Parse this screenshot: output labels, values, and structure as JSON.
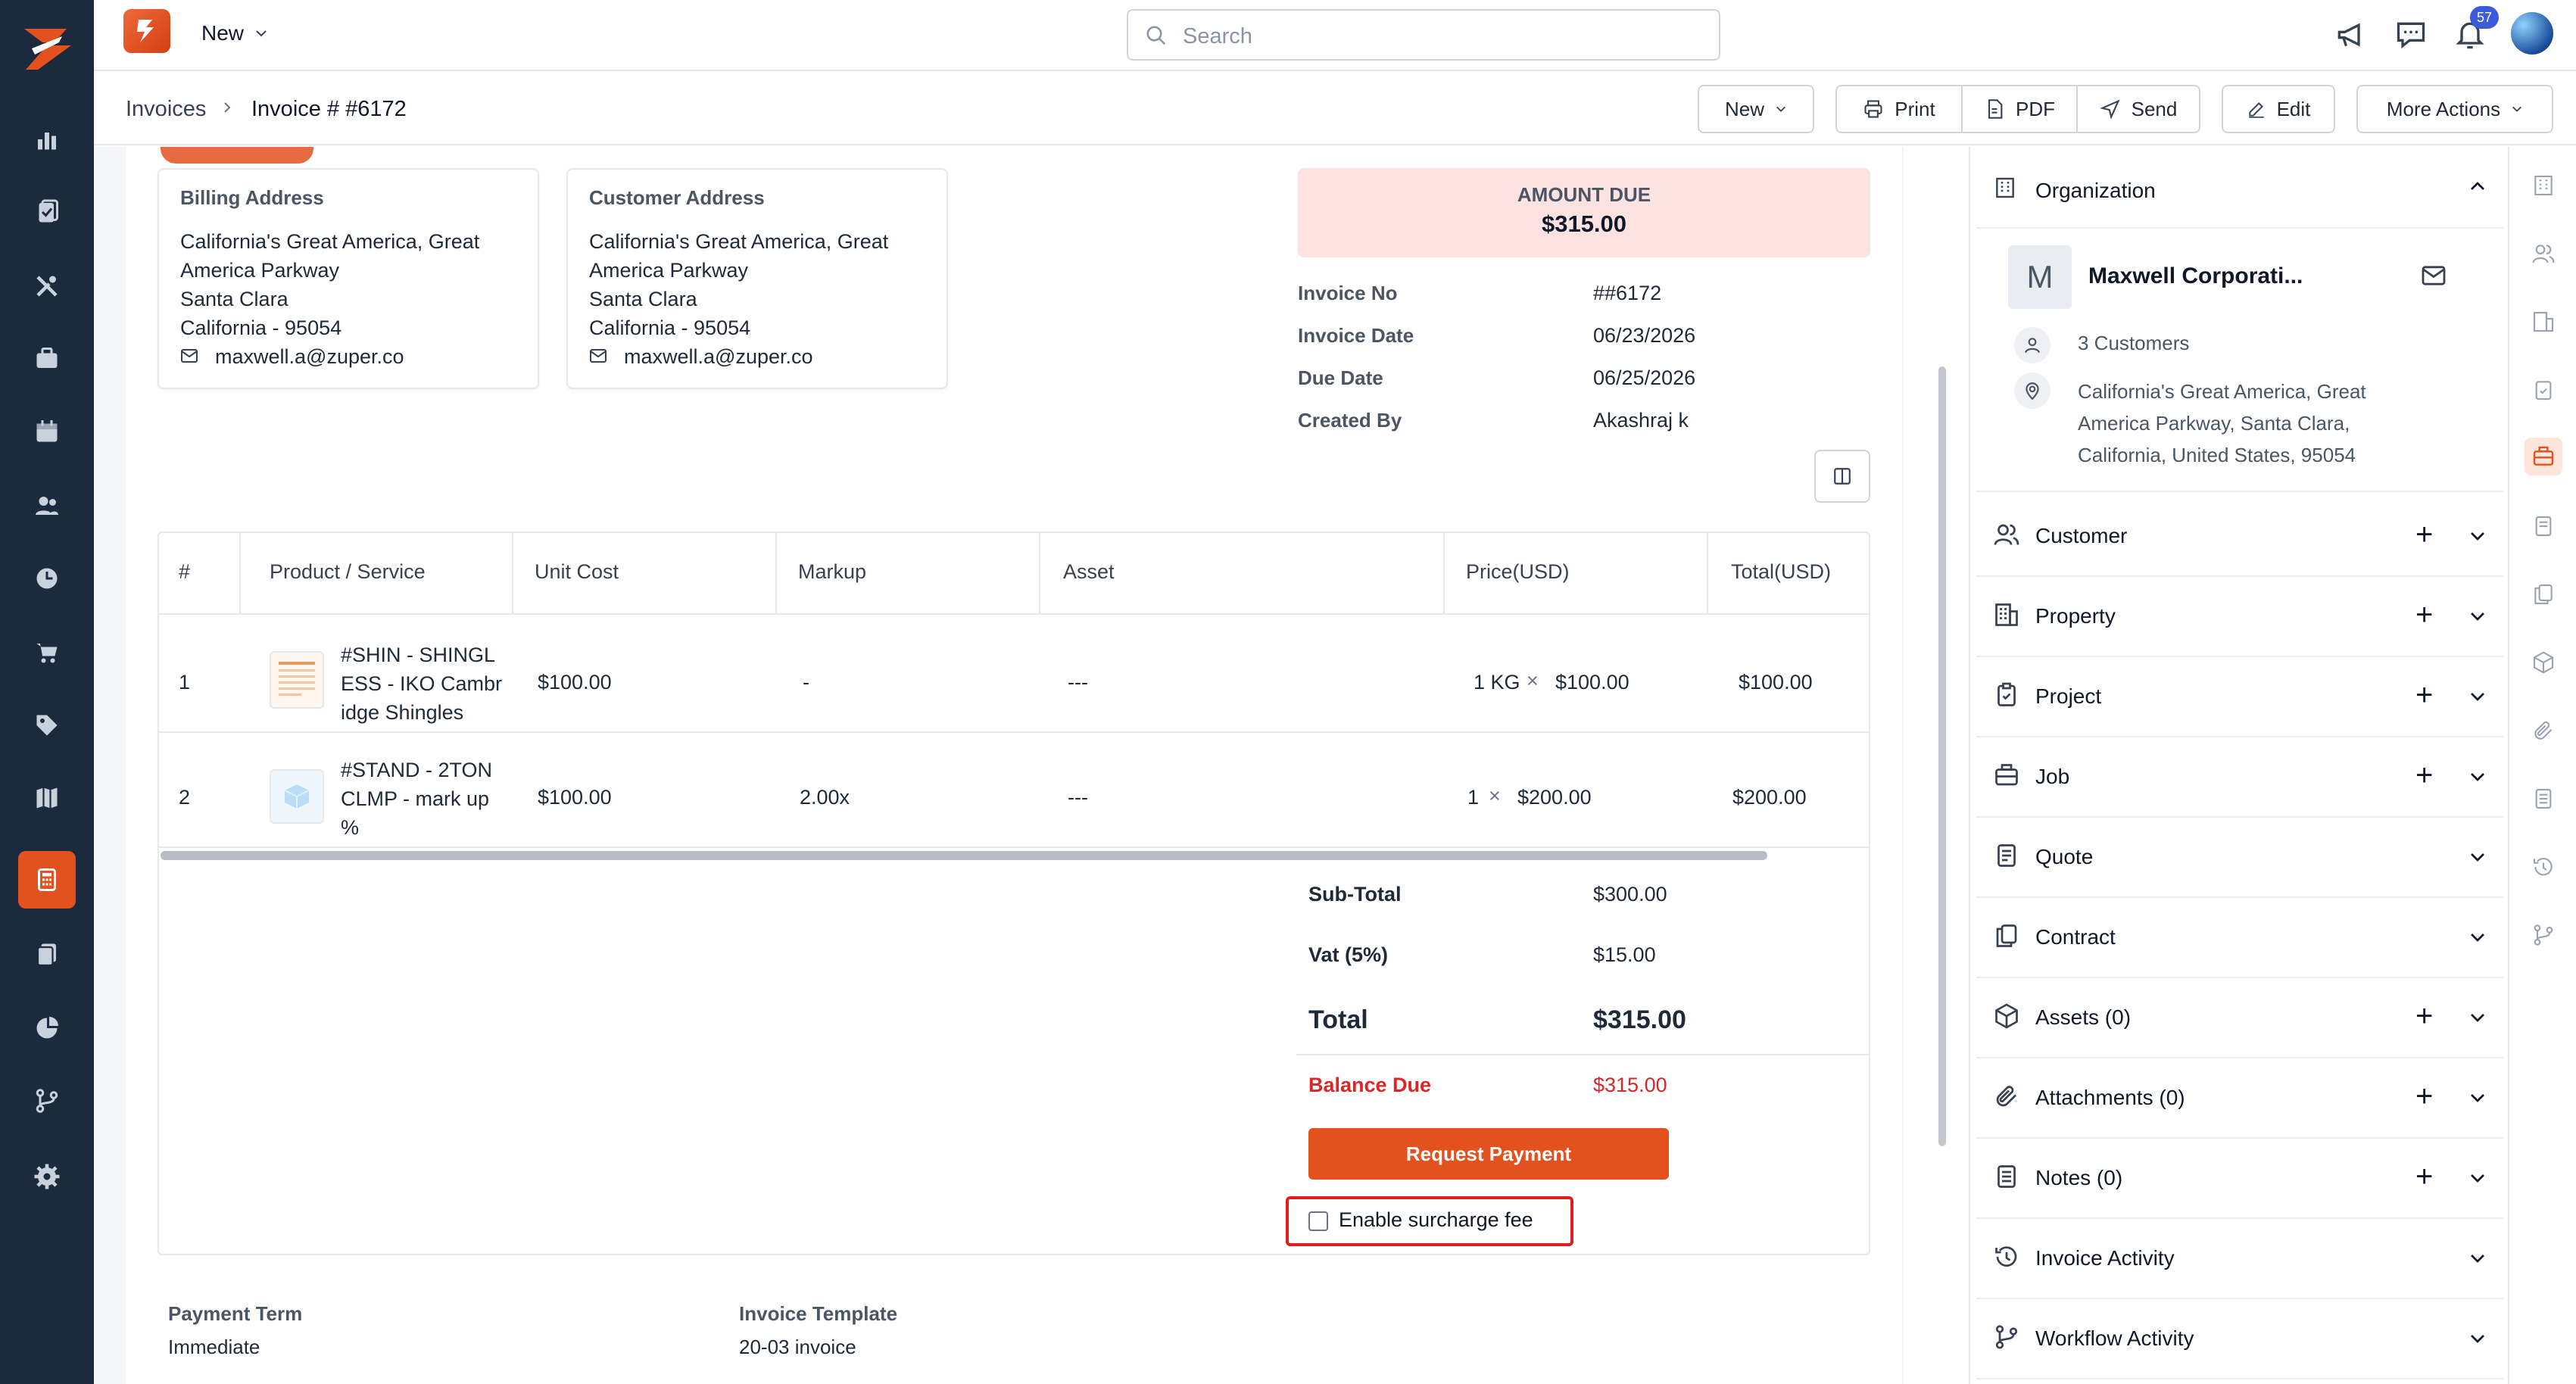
{
  "topbar": {
    "new_label": "New",
    "search_placeholder": "Search",
    "notification_count": "57"
  },
  "breadcrumb": {
    "parent": "Invoices",
    "current": "Invoice # #6172"
  },
  "toolbar": {
    "new_label": "New",
    "print_label": "Print",
    "pdf_label": "PDF",
    "send_label": "Send",
    "edit_label": "Edit",
    "more_actions_label": "More Actions"
  },
  "billing": {
    "title": "Billing Address",
    "line1": "California's Great America, Great",
    "line2": "America Parkway",
    "line3": "Santa Clara",
    "line4": "California - 95054",
    "email": "maxwell.a@zuper.co"
  },
  "customer_address": {
    "title": "Customer Address",
    "line1": "California's Great America, Great",
    "line2": "America Parkway",
    "line3": "Santa Clara",
    "line4": "California - 95054",
    "email": "maxwell.a@zuper.co"
  },
  "amount_due": {
    "label": "AMOUNT DUE",
    "value": "$315.00"
  },
  "invoice_meta": {
    "invoice_no_label": "Invoice No",
    "invoice_no": "##6172",
    "invoice_date_label": "Invoice Date",
    "invoice_date": "06/23/2026",
    "due_date_label": "Due Date",
    "due_date": "06/25/2026",
    "created_by_label": "Created By",
    "created_by": "Akashraj k"
  },
  "table": {
    "headers": [
      "#",
      "Product / Service",
      "Unit Cost",
      "Markup",
      "Asset",
      "Price(USD)",
      "Total(USD)"
    ],
    "rows": [
      {
        "num": "1",
        "name_l1": "#SHIN - SHINGL",
        "name_l2": "ESS - IKO Cambr",
        "name_l3": "idge Shingles",
        "unit_cost": "$100.00",
        "markup": "-",
        "asset": "---",
        "qty": "1 KG",
        "price": "$100.00",
        "total": "$100.00"
      },
      {
        "num": "2",
        "name_l1": "#STAND - 2TON",
        "name_l2": "CLMP - mark up",
        "name_l3": "%",
        "unit_cost": "$100.00",
        "markup": "2.00x",
        "asset": "---",
        "qty": "1",
        "price": "$200.00",
        "total": "$200.00"
      }
    ],
    "times_symbol": "×"
  },
  "summary": {
    "subtotal_label": "Sub-Total",
    "subtotal": "$300.00",
    "vat_label": "Vat (5%)",
    "vat": "$15.00",
    "total_label": "Total",
    "total": "$315.00",
    "balance_label": "Balance Due",
    "balance": "$315.00",
    "request_payment": "Request Payment",
    "surcharge_label": "Enable surcharge fee"
  },
  "footer": {
    "payment_term_label": "Payment Term",
    "payment_term": "Immediate",
    "template_label": "Invoice Template",
    "template": "20-03 invoice"
  },
  "right_panel": {
    "organization_label": "Organization",
    "org_initial": "M",
    "org_name": "Maxwell Corporati...",
    "customers_count": "3 Customers",
    "org_addr1": "California's Great America, Great",
    "org_addr2": "America Parkway, Santa Clara,",
    "org_addr3": "California, United States, 95054",
    "items": [
      {
        "label": "Customer"
      },
      {
        "label": "Property"
      },
      {
        "label": "Project"
      },
      {
        "label": "Job"
      },
      {
        "label": "Quote"
      },
      {
        "label": "Contract"
      },
      {
        "label": "Assets (0)"
      },
      {
        "label": "Attachments (0)"
      },
      {
        "label": "Notes (0)"
      },
      {
        "label": "Invoice Activity"
      },
      {
        "label": "Workflow Activity"
      }
    ]
  },
  "colors": {
    "accent": "#e3511e",
    "nav_bg": "#1b2a3d",
    "amount_due_bg": "#fde2e2",
    "balance_due": "#dc2626",
    "highlight_border": "#e11d1d"
  }
}
